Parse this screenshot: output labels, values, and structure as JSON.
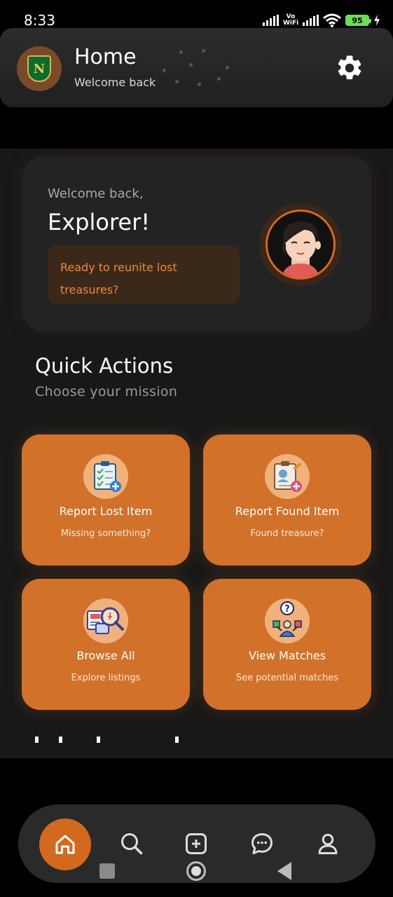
{
  "status_bar": {
    "time": "8:33",
    "network_label": "Vo WiFi",
    "battery": "95"
  },
  "header": {
    "title": "Home",
    "subtitle": "Welcome back",
    "settings_icon": "gear-icon",
    "logo_letter": "N"
  },
  "welcome_card": {
    "greeting": "Welcome back,",
    "name": "Explorer!",
    "tagline": "Ready to reunite lost treasures?"
  },
  "quick_actions": {
    "title": "Quick Actions",
    "subtitle": "Choose your mission",
    "items": [
      {
        "label": "Report Lost Item",
        "description": "Missing something?",
        "icon": "clipboard-checklist-icon"
      },
      {
        "label": "Report Found Item",
        "description": "Found treasure?",
        "icon": "clipboard-person-icon"
      },
      {
        "label": "Browse All",
        "description": "Explore listings",
        "icon": "magnifier-listings-icon"
      },
      {
        "label": "View Matches",
        "description": "See potential matches",
        "icon": "person-question-icon"
      }
    ]
  },
  "bottom_nav": {
    "items": [
      "home-icon",
      "search-icon",
      "add-icon",
      "chat-icon",
      "profile-icon"
    ],
    "active": "home-icon"
  },
  "colors": {
    "accent": "#d2722a",
    "card_bg": "#232323",
    "tagline_bg": "#3a2818",
    "tagline_text": "#f0883a"
  }
}
